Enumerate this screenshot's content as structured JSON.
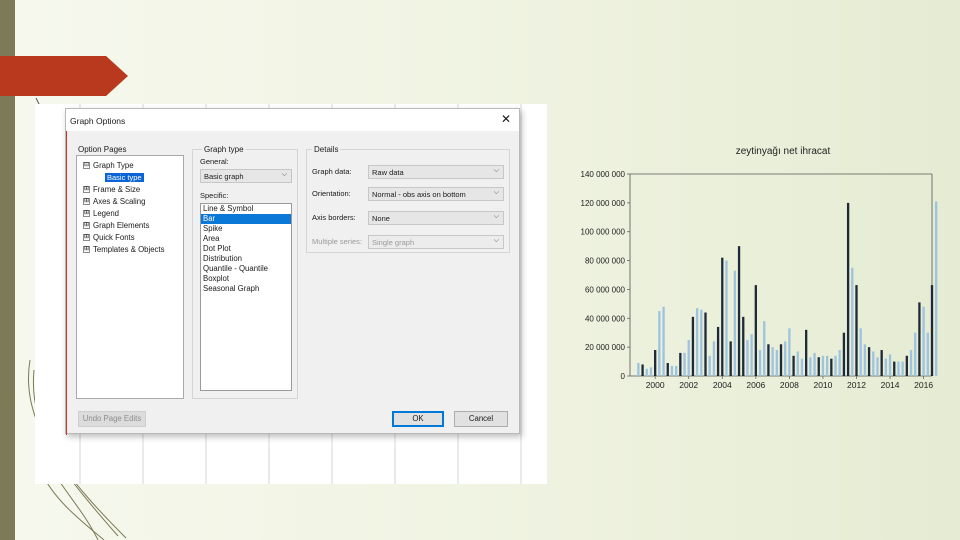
{
  "dialog": {
    "title": "Graph Options",
    "close_label": "✕",
    "option_pages": {
      "heading": "Option Pages",
      "items": [
        {
          "toggle": "⊟",
          "label": "Graph Type"
        },
        {
          "toggle": "⊞",
          "label": "Frame & Size"
        },
        {
          "toggle": "⊞",
          "label": "Axes & Scaling"
        },
        {
          "toggle": "⊞",
          "label": "Legend"
        },
        {
          "toggle": "⊞",
          "label": "Graph Elements"
        },
        {
          "toggle": "⊞",
          "label": "Quick Fonts"
        },
        {
          "toggle": "⊞",
          "label": "Templates & Objects"
        }
      ],
      "sub_item": "Basic type"
    },
    "graph_type": {
      "heading": "Graph type",
      "general_label": "General:",
      "general_value": "Basic graph",
      "specific_label": "Specific:",
      "specific_items": [
        "Line & Symbol",
        "Bar",
        "Spike",
        "Area",
        "Dot Plot",
        "Distribution",
        "Quantile - Quantile",
        "Boxplot",
        "Seasonal Graph"
      ],
      "selected_index": 1
    },
    "details": {
      "heading": "Details",
      "graph_data_label": "Graph data:",
      "graph_data_value": "Raw data",
      "orientation_label": "Orientation:",
      "orientation_value": "Normal - obs axis on bottom",
      "axis_borders_label": "Axis borders:",
      "axis_borders_value": "None",
      "multiple_series_label": "Multiple series:",
      "multiple_series_value": "Single graph"
    },
    "undo_label": "Undo Page Edits",
    "ok_label": "OK",
    "cancel_label": "Cancel"
  },
  "colors": {
    "accent_red": "#b8391d",
    "rail": "#7d7a57",
    "bar_light": "#9ec3df",
    "bar_dark": "#1f2a38"
  },
  "chart_data": {
    "type": "bar",
    "title": "zeytinyağı net ihracat",
    "xlabel": "",
    "ylabel": "",
    "ylim": [
      0,
      140000000
    ],
    "y_ticks": [
      0,
      20000000,
      40000000,
      60000000,
      80000000,
      100000000,
      120000000,
      140000000
    ],
    "y_tick_labels": [
      "0",
      "20 000 000",
      "40 000 000",
      "60 000 000",
      "80 000 000",
      "100 000 000",
      "120 000 000",
      "140 000 000"
    ],
    "x_tick_labels": [
      "2000",
      "2002",
      "2004",
      "2006",
      "2008",
      "2010",
      "2012",
      "2014",
      "2016"
    ],
    "x_range": [
      1999,
      2017
    ],
    "periods_per_year": 4,
    "grid": false,
    "series": [
      {
        "values": [
          9000000,
          8000000,
          5000000,
          6000000,
          18000000,
          45000000,
          48000000,
          9000000,
          7000000,
          7000000,
          16000000,
          16000000,
          25000000,
          41000000,
          47000000,
          46000000,
          44000000,
          14000000,
          24000000,
          34000000,
          82000000,
          80000000,
          24000000,
          73000000,
          90000000,
          41000000,
          25000000,
          29000000,
          63000000,
          18000000,
          38000000,
          22000000,
          20000000,
          18000000,
          22000000,
          24000000,
          33000000,
          14000000,
          17000000,
          12000000,
          32000000,
          13000000,
          16000000,
          13000000,
          14000000,
          14000000,
          12000000,
          14000000,
          18000000,
          30000000,
          120000000,
          75000000,
          63000000,
          33000000,
          22000000,
          20000000,
          17000000,
          13000000,
          18000000,
          12000000,
          15000000,
          10000000,
          10000000,
          10000000,
          14000000,
          18000000,
          30000000,
          51000000,
          48000000,
          30000000,
          63000000,
          121000000
        ]
      }
    ]
  }
}
